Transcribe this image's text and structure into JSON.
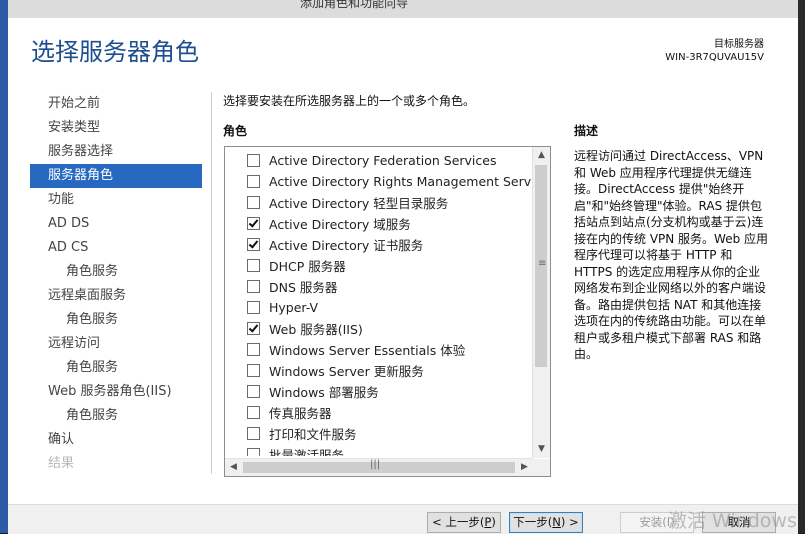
{
  "window": {
    "title": "添加角色和功能向导"
  },
  "page": {
    "title": "选择服务器角色"
  },
  "destination": {
    "label": "目标服务器",
    "server": "WIN-3R7QUVAU15V"
  },
  "nav": {
    "items": [
      {
        "label": "开始之前",
        "level": 0,
        "state": "normal"
      },
      {
        "label": "安装类型",
        "level": 0,
        "state": "normal"
      },
      {
        "label": "服务器选择",
        "level": 0,
        "state": "normal"
      },
      {
        "label": "服务器角色",
        "level": 0,
        "state": "active"
      },
      {
        "label": "功能",
        "level": 0,
        "state": "normal"
      },
      {
        "label": "AD DS",
        "level": 0,
        "state": "normal"
      },
      {
        "label": "AD CS",
        "level": 0,
        "state": "normal"
      },
      {
        "label": "角色服务",
        "level": 1,
        "state": "normal"
      },
      {
        "label": "远程桌面服务",
        "level": 0,
        "state": "normal"
      },
      {
        "label": "角色服务",
        "level": 1,
        "state": "normal"
      },
      {
        "label": "远程访问",
        "level": 0,
        "state": "normal"
      },
      {
        "label": "角色服务",
        "level": 1,
        "state": "normal"
      },
      {
        "label": "Web 服务器角色(IIS)",
        "level": 0,
        "state": "normal"
      },
      {
        "label": "角色服务",
        "level": 1,
        "state": "normal"
      },
      {
        "label": "确认",
        "level": 0,
        "state": "normal"
      },
      {
        "label": "结果",
        "level": 0,
        "state": "disabled"
      }
    ]
  },
  "main": {
    "instruction": "选择要安装在所选服务器上的一个或多个角色。",
    "roles_label": "角色",
    "roles": [
      {
        "label": "Active Directory Federation Services",
        "checked": false
      },
      {
        "label": "Active Directory Rights Management Services",
        "checked": false
      },
      {
        "label": "Active Directory 轻型目录服务",
        "checked": false
      },
      {
        "label": "Active Directory 域服务",
        "checked": true
      },
      {
        "label": "Active Directory 证书服务",
        "checked": true
      },
      {
        "label": "DHCP 服务器",
        "checked": false
      },
      {
        "label": "DNS 服务器",
        "checked": false
      },
      {
        "label": "Hyper-V",
        "checked": false
      },
      {
        "label": "Web 服务器(IIS)",
        "checked": true
      },
      {
        "label": "Windows Server Essentials 体验",
        "checked": false
      },
      {
        "label": "Windows Server 更新服务",
        "checked": false
      },
      {
        "label": "Windows 部署服务",
        "checked": false
      },
      {
        "label": "传真服务器",
        "checked": false
      },
      {
        "label": "打印和文件服务",
        "checked": false
      },
      {
        "label": "批量激活服务",
        "checked": false
      }
    ],
    "description_label": "描述",
    "description": "远程访问通过 DirectAccess、VPN 和 Web 应用程序代理提供无缝连接。DirectAccess 提供\"始终开启\"和\"始终管理\"体验。RAS 提供包括站点到站点(分支机构或基于云)连接在内的传统 VPN 服务。Web 应用程序代理可以将基于 HTTP 和 HTTPS 的选定应用程序从你的企业网络发布到企业网络以外的客户端设备。路由提供包括 NAT 和其他连接选项在内的传统路由功能。可以在单租户或多租户模式下部署 RAS 和路由。"
  },
  "buttons": {
    "prev": {
      "label": "< 上一步(",
      "key": "P",
      "suffix": ")"
    },
    "next": {
      "label": "下一步(",
      "key": "N",
      "suffix": ") >"
    },
    "install": {
      "label": "安装(I)"
    },
    "cancel": {
      "label": "取消"
    }
  },
  "watermark": {
    "text": "激活 Windows"
  }
}
